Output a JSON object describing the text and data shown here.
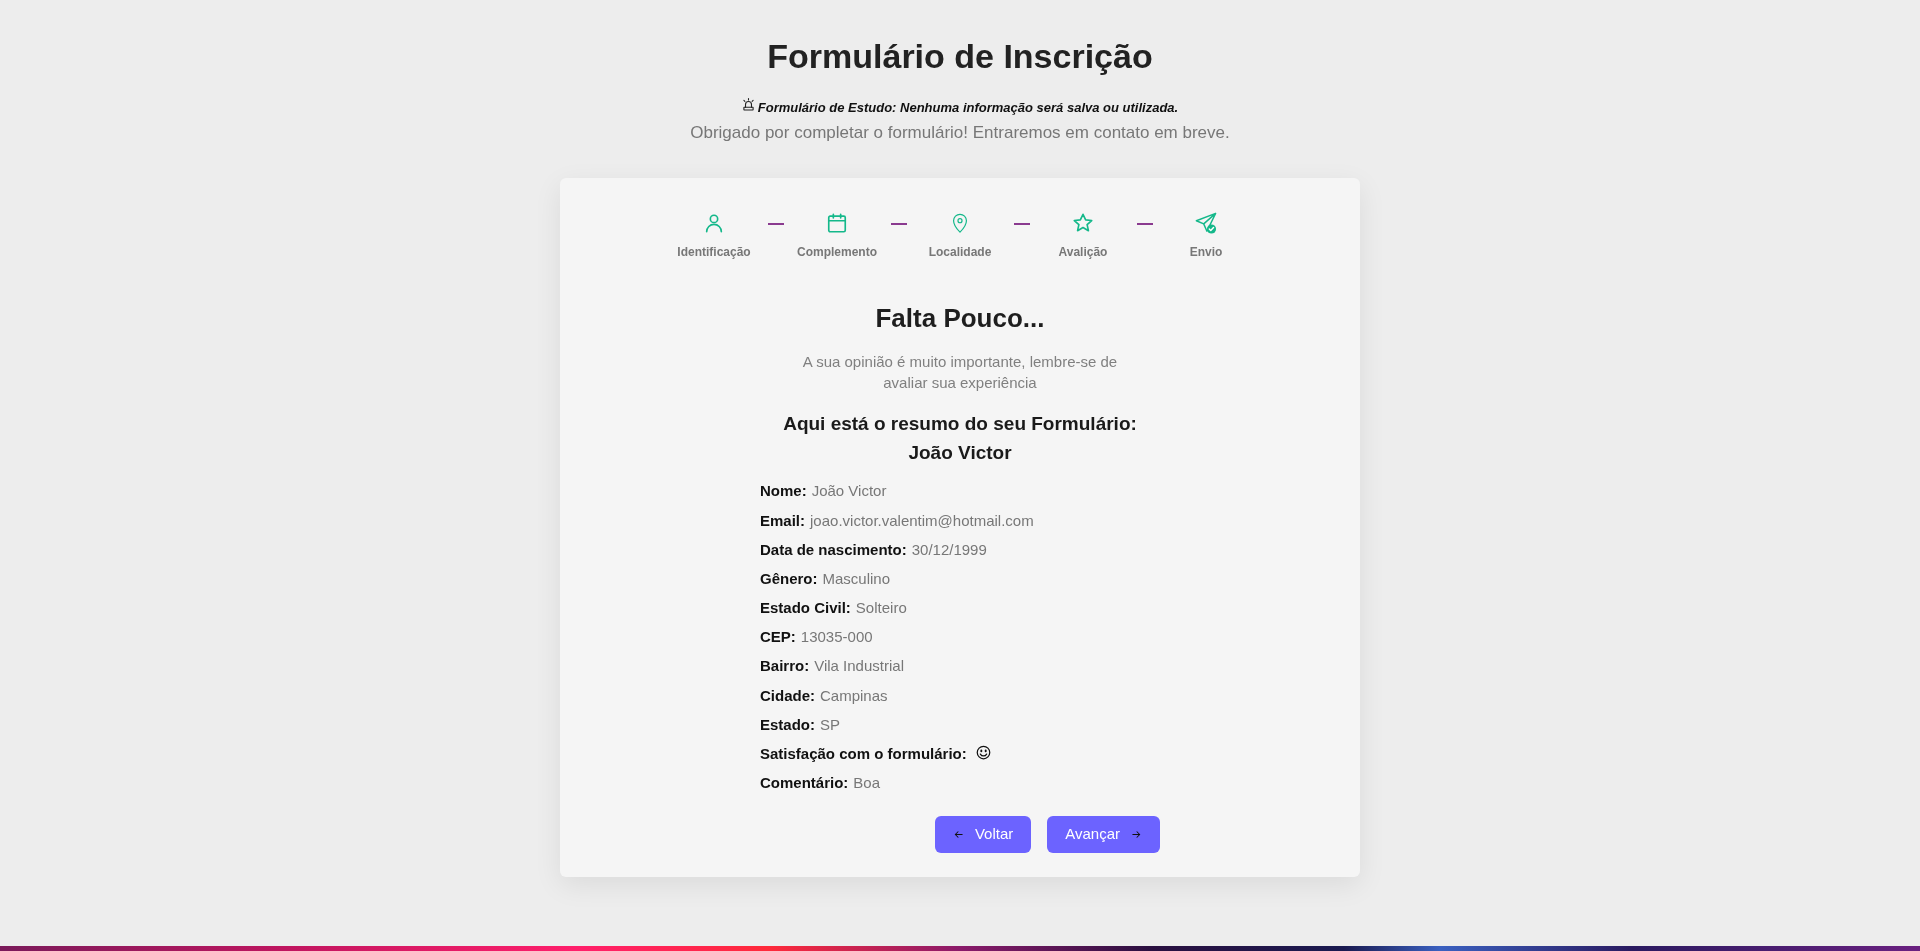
{
  "header": {
    "title": "Formulário de Inscrição",
    "notice": "Formulário de Estudo: Nenhuma informação será salva ou utilizada.",
    "thanks": "Obrigado por completar o formulário! Entraremos em contato em breve."
  },
  "steps": [
    {
      "label": "Identificação"
    },
    {
      "label": "Complemento"
    },
    {
      "label": "Localidade"
    },
    {
      "label": "Avalição"
    },
    {
      "label": "Envio"
    }
  ],
  "card": {
    "heading": "Falta Pouco...",
    "message": "A sua opinião é muito importante, lembre-se de avaliar sua experiência",
    "summary_title": "Aqui está o resumo do seu Formulário:",
    "summary_name": "João Victor",
    "fields": [
      {
        "kind": "text",
        "label": "Nome:",
        "value": "João Victor"
      },
      {
        "kind": "text",
        "label": "Email:",
        "value": "joao.victor.valentim@hotmail.com"
      },
      {
        "kind": "text",
        "label": "Data de nascimento:",
        "value": "30/12/1999"
      },
      {
        "kind": "text",
        "label": "Gênero:",
        "value": "Masculino"
      },
      {
        "kind": "text",
        "label": "Estado Civil:",
        "value": "Solteiro"
      },
      {
        "kind": "text",
        "label": "CEP:",
        "value": "13035-000"
      },
      {
        "kind": "text",
        "label": "Bairro:",
        "value": "Vila Industrial"
      },
      {
        "kind": "text",
        "label": "Cidade:",
        "value": "Campinas"
      },
      {
        "kind": "text",
        "label": "Estado:",
        "value": "SP"
      },
      {
        "kind": "smiley",
        "label": "Satisfação com o formulário:"
      },
      {
        "kind": "text",
        "label": "Comentário:",
        "value": "Boa"
      }
    ],
    "buttons": [
      {
        "kind": "back",
        "label": "Voltar"
      },
      {
        "kind": "next",
        "label": "Avançar"
      }
    ]
  }
}
